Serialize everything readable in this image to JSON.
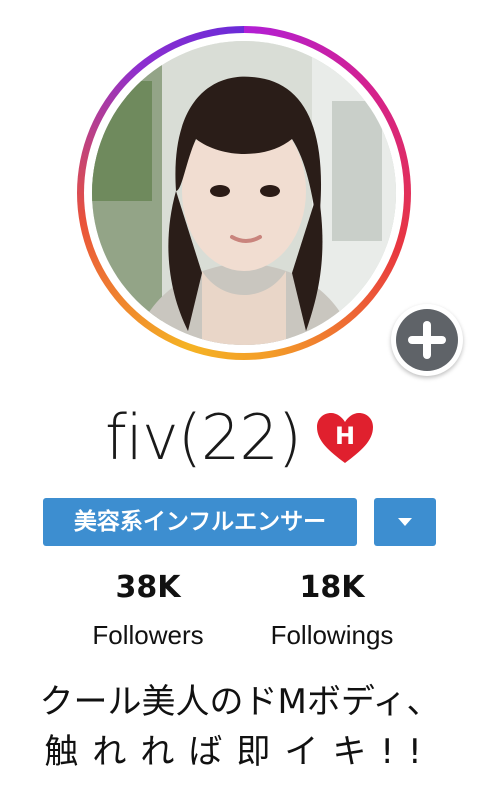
{
  "profile": {
    "name": "fiv(22)",
    "badge_letter": "H",
    "tag_label": "美容系インフルエンサー",
    "stats": [
      {
        "count": "38K",
        "label": "Followers"
      },
      {
        "count": "18K",
        "label": "Followings"
      }
    ],
    "bio_line1": "クール美人のドMボディ、",
    "bio_line2": "触れれば即イキ!!"
  },
  "icons": {
    "add": "plus-icon",
    "badge": "heart-icon",
    "dropdown": "chevron-down-icon"
  },
  "colors": {
    "accent_blue": "#3d8ed0",
    "badge_red": "#e0202e",
    "add_button_gray": "#5f6368"
  }
}
